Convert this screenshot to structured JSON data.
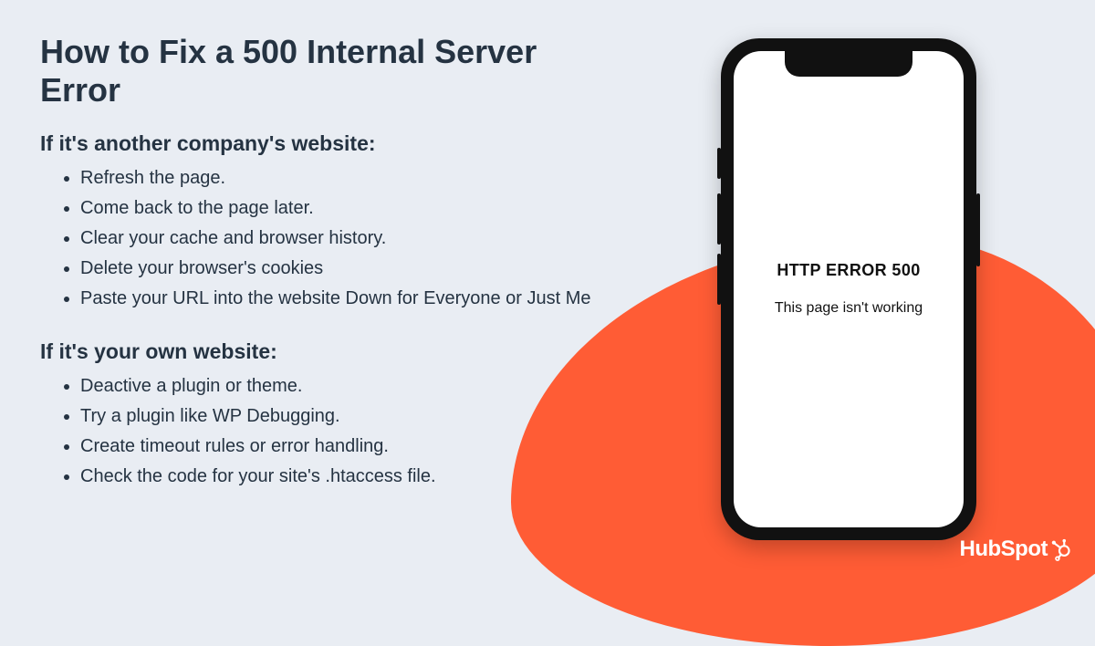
{
  "title": "How to Fix a 500 Internal Server Error",
  "section1": {
    "heading": "If it's another company's website:",
    "items": [
      "Refresh the page.",
      "Come back to the page later.",
      "Clear your cache and browser history.",
      "Delete your browser's cookies",
      "Paste your URL into the website Down for Everyone or Just Me"
    ]
  },
  "section2": {
    "heading": "If it's your own website:",
    "items": [
      "Deactive a plugin or theme.",
      "Try a plugin like WP Debugging.",
      "Create timeout rules or error handling.",
      "Check the code for your site's .htaccess file."
    ]
  },
  "phone": {
    "error_title": "HTTP ERROR 500",
    "error_subtitle": "This page isn't working"
  },
  "brand": "HubSpot",
  "colors": {
    "accent": "#FF5C35",
    "text": "#253342",
    "background": "#E9EDF3"
  }
}
